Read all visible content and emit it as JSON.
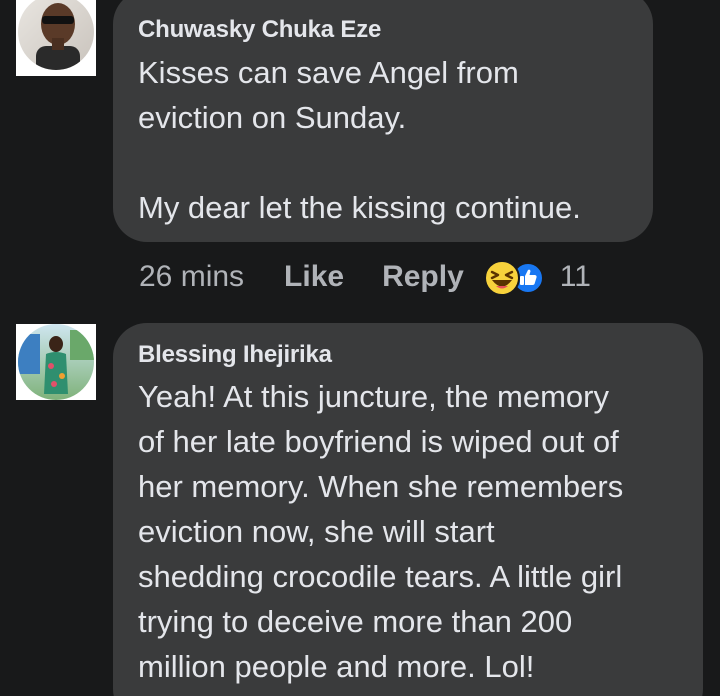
{
  "comments": [
    {
      "author": "Chuwasky Chuka Eze",
      "text": "Kisses can save Angel from\neviction on Sunday.\n\nMy dear let the kissing continue.",
      "time": "26 mins",
      "like_label": "Like",
      "reply_label": "Reply",
      "reactions": [
        "haha-icon",
        "like-icon"
      ],
      "reaction_count": "11"
    },
    {
      "author": "Blessing Ihejirika",
      "text": "Yeah! At this juncture, the memory\nof her late boyfriend is wiped out of\nher memory. When she remembers\neviction now, she will start\nshedding crocodile tears. A little girl\ntrying to deceive more than 200\nmillion people and more. Lol!"
    }
  ],
  "colors": {
    "background": "#18191a",
    "bubble": "#3a3b3c",
    "text": "#e4e6eb",
    "meta": "#b0b3b8",
    "like_blue": "#1877f2",
    "haha_yellow": "#f7d23c"
  }
}
